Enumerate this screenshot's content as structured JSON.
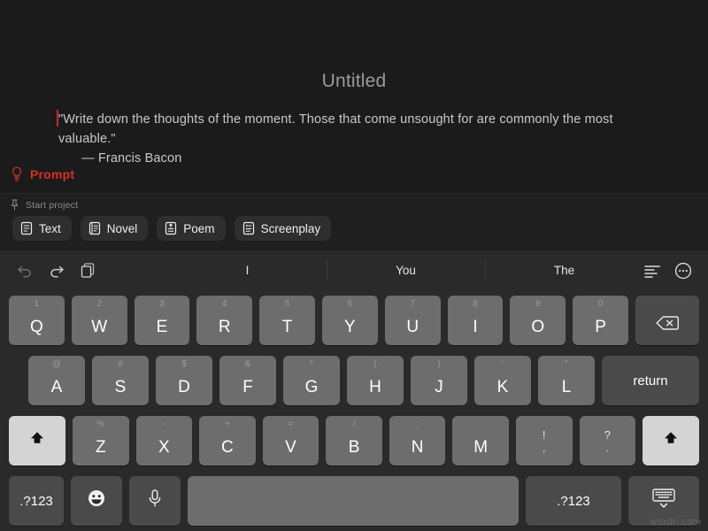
{
  "editor": {
    "title": "Untitled",
    "body_line1": "\"Write down the thoughts of the moment. Those that come unsought for are commonly the",
    "body_line2": "most valuable.\"",
    "attribution": "— Francis Bacon",
    "prompt_label": "Prompt",
    "prompt_color": "#d93025",
    "caret_color": "#c62828"
  },
  "projects": {
    "start_label": "Start project",
    "pin_icon": "pin-icon",
    "chips": [
      {
        "label": "Text",
        "icon": "document-text-icon"
      },
      {
        "label": "Novel",
        "icon": "book-icon"
      },
      {
        "label": "Poem",
        "icon": "poem-document-icon"
      },
      {
        "label": "Screenplay",
        "icon": "screenplay-document-icon"
      }
    ]
  },
  "suggestion_bar": {
    "undo_icon": "undo-icon",
    "redo_icon": "redo-icon",
    "paste_icon": "paste-icon",
    "format_icon": "text-format-icon",
    "more_icon": "more-circle-icon",
    "suggestions": [
      "I",
      "You",
      "The"
    ]
  },
  "keyboard": {
    "row1": [
      {
        "key": "Q",
        "hint": "1"
      },
      {
        "key": "W",
        "hint": "2"
      },
      {
        "key": "E",
        "hint": "3"
      },
      {
        "key": "R",
        "hint": "4"
      },
      {
        "key": "T",
        "hint": "5"
      },
      {
        "key": "Y",
        "hint": "6"
      },
      {
        "key": "U",
        "hint": "7"
      },
      {
        "key": "I",
        "hint": "8"
      },
      {
        "key": "O",
        "hint": "9"
      },
      {
        "key": "P",
        "hint": "0"
      }
    ],
    "row2": [
      {
        "key": "A",
        "hint": "@"
      },
      {
        "key": "S",
        "hint": "#"
      },
      {
        "key": "D",
        "hint": "$"
      },
      {
        "key": "F",
        "hint": "&"
      },
      {
        "key": "G",
        "hint": "*"
      },
      {
        "key": "H",
        "hint": "("
      },
      {
        "key": "J",
        "hint": ")"
      },
      {
        "key": "K",
        "hint": "'"
      },
      {
        "key": "L",
        "hint": "\""
      }
    ],
    "row3": [
      {
        "key": "Z",
        "hint": "%"
      },
      {
        "key": "X",
        "hint": "-"
      },
      {
        "key": "C",
        "hint": "+"
      },
      {
        "key": "V",
        "hint": "="
      },
      {
        "key": "B",
        "hint": "/"
      },
      {
        "key": "N",
        "hint": ";"
      },
      {
        "key": "M",
        "hint": ":"
      }
    ],
    "punct": [
      {
        "upper": "!",
        "lower": ","
      },
      {
        "upper": "?",
        "lower": "."
      }
    ],
    "backspace_icon": "backspace-icon",
    "return_label": "return",
    "shift_icon": "shift-icon",
    "numbers_left_label": ".?123",
    "emoji_icon": "emoji-icon",
    "mic_icon": "microphone-icon",
    "space_label": "",
    "numbers_right_label": ".?123",
    "dismiss_icon": "dismiss-keyboard-icon"
  },
  "watermark": {
    "text": "wsxdn.com"
  }
}
